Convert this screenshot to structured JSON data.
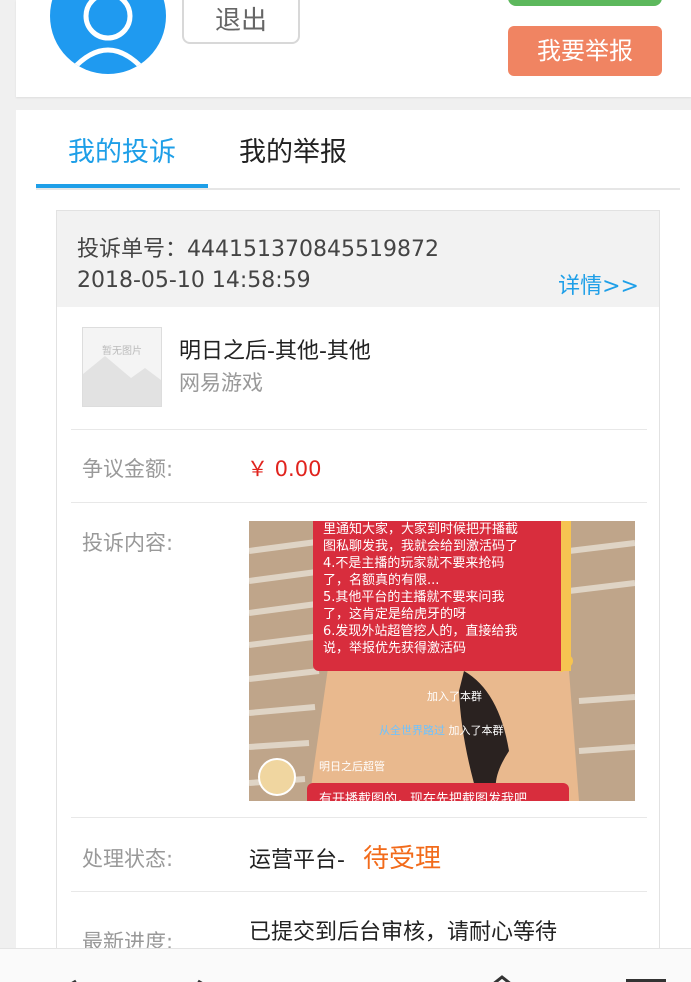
{
  "header": {
    "logout_label": "退出",
    "report_button_label": "我要举报"
  },
  "tabs": [
    {
      "label": "我的投诉",
      "active": true
    },
    {
      "label": "我的举报",
      "active": false
    }
  ],
  "complaint": {
    "order_label": "投诉单号：",
    "order_number": "444151370845519872",
    "datetime": "2018-05-10 14:58:59",
    "detail_link": "详情>>",
    "no_image_text": "暂无图片",
    "product_title": "明日之后-其他-其他",
    "product_sub": "网易游戏",
    "amount_label": "争议金额:",
    "amount_value": "￥ 0.00",
    "content_label": "投诉内容:",
    "screenshot": {
      "text": "里通知大家，大家到时候把开播截\n图私聊发我，我就会给到激活码了\n4.不是主播的玩家就不要来抢码\n了，名额真的有限...\n5.其他平台的主播就不要来问我\n了，这肯定是给虎牙的呀\n6.发现外站超管挖人的，直接给我\n说，举报优先获得激活码",
      "join_msg_1": "加入了本群",
      "join_name_2": "从全世界路过",
      "join_msg_2": "加入了本群",
      "sender_name": "明日之后超管",
      "last_line": "有开播截图的，现在先把截图发我吧"
    },
    "status_label": "处理状态:",
    "status_prefix": "运营平台-",
    "status_value": "待受理",
    "progress_label": "最新进度:",
    "progress_value": "已提交到后台审核，请耐心等待"
  },
  "colors": {
    "accent": "#1e9fe8",
    "report_button": "#f08462",
    "amount": "#e0231d",
    "status": "#f26b1b"
  }
}
